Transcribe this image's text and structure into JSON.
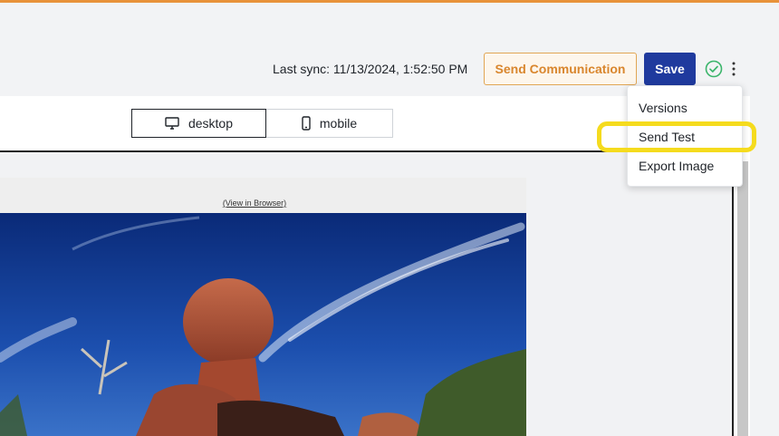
{
  "header": {
    "last_sync": "Last sync: 11/13/2024, 1:52:50 PM",
    "send_communication_label": "Send Communication",
    "save_label": "Save",
    "status_icon": "check-circle-icon",
    "menu_icon": "kebab-icon"
  },
  "device_toggle": {
    "desktop_label": "desktop",
    "mobile_label": "mobile",
    "selected": "desktop"
  },
  "preview": {
    "view_in_browser": "(View in Browser)"
  },
  "menu": {
    "items": [
      {
        "label": "Versions"
      },
      {
        "label": "Send Test",
        "highlighted": true
      },
      {
        "label": "Export Image"
      }
    ]
  },
  "colors": {
    "accent_orange": "#e8923a",
    "save_blue": "#1f3a9e",
    "success_green": "#3bb56b",
    "highlight_yellow": "#f5db1e"
  }
}
